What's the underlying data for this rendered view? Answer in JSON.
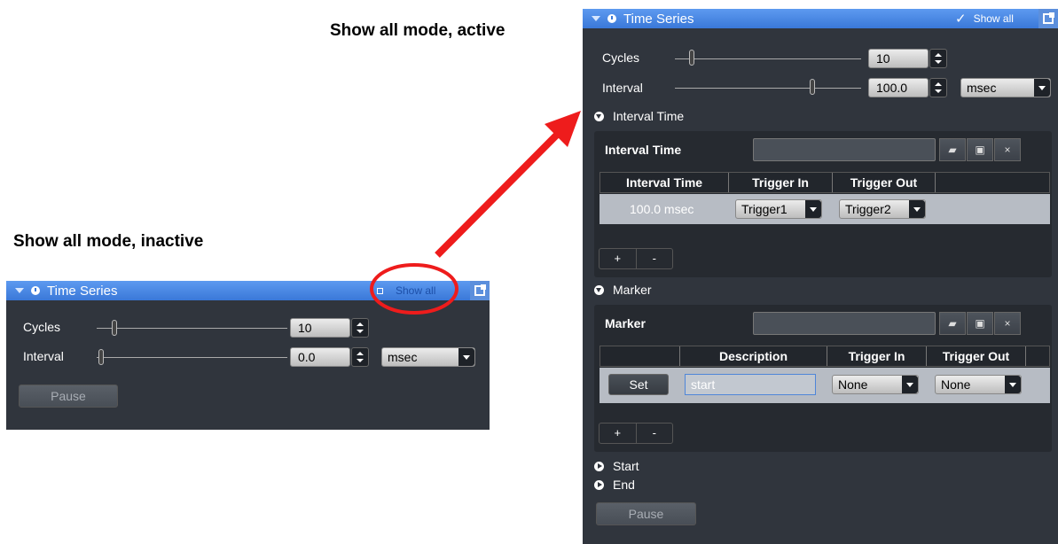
{
  "captions": {
    "active": "Show all mode, active",
    "inactive": "Show all mode, inactive"
  },
  "colors": {
    "titlebar": "#3a78d8",
    "panel_bg": "#30353d",
    "arrow": "#ee1c1c",
    "highlight_ring": "#ee1c1c"
  },
  "inactive_panel": {
    "title": "Time Series",
    "show_all_label": "Show all",
    "show_all_checked": false,
    "cycles_label": "Cycles",
    "cycles_value": "10",
    "cycles_slider_level": 0.08,
    "interval_label": "Interval",
    "interval_value": "0.0",
    "interval_slider_level": 0.0,
    "interval_unit": "msec",
    "pause_label": "Pause"
  },
  "active_panel": {
    "title": "Time Series",
    "show_all_label": "Show all",
    "show_all_checked": true,
    "cycles_label": "Cycles",
    "cycles_value": "10",
    "cycles_slider_level": 0.08,
    "interval_label": "Interval",
    "interval_value": "100.0",
    "interval_slider_level": 0.72,
    "interval_unit": "msec",
    "interval_time_section": {
      "header": "Interval Time",
      "field_label": "Interval Time",
      "field_value": "",
      "columns": [
        "Interval Time",
        "Trigger In",
        "Trigger Out"
      ],
      "rows": [
        {
          "interval": "100.0 msec",
          "trigger_in": "Trigger1",
          "trigger_out": "Trigger2"
        }
      ],
      "add_label": "+",
      "remove_label": "-"
    },
    "marker_section": {
      "header": "Marker",
      "field_label": "Marker",
      "field_value": "",
      "columns": [
        "",
        "Description",
        "Trigger In",
        "Trigger Out"
      ],
      "rows": [
        {
          "set_label": "Set",
          "description": "start",
          "trigger_in": "None",
          "trigger_out": "None"
        }
      ],
      "add_label": "+",
      "remove_label": "-"
    },
    "start_label": "Start",
    "end_label": "End",
    "pause_label": "Pause"
  },
  "icons": [
    "collapse-triangle-icon",
    "clock-icon",
    "detach-icon",
    "checkmark-icon",
    "folder-open-icon",
    "save-icon",
    "close-icon"
  ]
}
